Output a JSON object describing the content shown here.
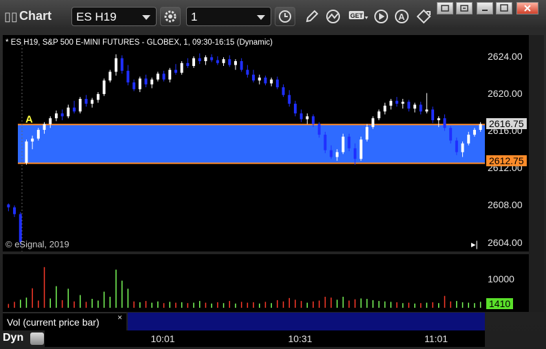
{
  "window": {
    "title": "Chart"
  },
  "toolbar": {
    "symbol": "ES H19",
    "interval": "1"
  },
  "chart": {
    "header": "* ES H19, S&P 500 E-MINI FUTURES - GLOBEX, 1, 09:30-16:15 (Dynamic)",
    "copyright": "© eSignal, 2019",
    "marker_label": "A",
    "price_axis": [
      "2624.00",
      "2620.00",
      "2616.00",
      "2612.00",
      "2608.00",
      "2604.00"
    ],
    "price_tags": {
      "last": "2616.75",
      "level": "2612.75"
    },
    "volume_axis": [
      "10000"
    ],
    "volume_tag": "1410",
    "time_axis": [
      "10:01",
      "10:31",
      "11:01"
    ],
    "volume_study_label": "Vol (current price bar)",
    "volume_close": "×",
    "mode_label": "Dyn",
    "colors": {
      "band": "#2f6bff",
      "line": "#ff8c2a",
      "up": "#ffffff",
      "down": "#1f2fff",
      "vol_up": "#7cff5a",
      "vol_down": "#ff3a2a"
    }
  },
  "chart_data": {
    "type": "candlestick",
    "ylim": [
      2604,
      2625
    ],
    "price_levels": [
      2616.75,
      2612.75
    ],
    "candles": [
      [
        2608.5,
        2608.6,
        2607.8,
        2608.2
      ],
      [
        2608.2,
        2608.4,
        2607.2,
        2607.5
      ],
      [
        2607.5,
        2607.7,
        2604.3,
        2604.6
      ],
      [
        2612.8,
        2615.2,
        2612.6,
        2615.0
      ],
      [
        2615.0,
        2615.6,
        2614.2,
        2615.3
      ],
      [
        2615.3,
        2616.4,
        2615.1,
        2616.2
      ],
      [
        2616.2,
        2617.0,
        2615.8,
        2616.8
      ],
      [
        2616.8,
        2617.6,
        2616.4,
        2617.4
      ],
      [
        2617.4,
        2618.2,
        2617.1,
        2617.9
      ],
      [
        2617.9,
        2618.3,
        2617.2,
        2617.6
      ],
      [
        2617.6,
        2618.8,
        2617.4,
        2618.5
      ],
      [
        2618.5,
        2619.2,
        2617.9,
        2618.1
      ],
      [
        2618.1,
        2619.6,
        2617.9,
        2619.4
      ],
      [
        2619.4,
        2619.8,
        2618.6,
        2618.9
      ],
      [
        2618.9,
        2619.5,
        2618.5,
        2619.3
      ],
      [
        2619.3,
        2620.1,
        2619.0,
        2619.9
      ],
      [
        2619.9,
        2621.5,
        2619.7,
        2621.3
      ],
      [
        2621.3,
        2622.4,
        2621.1,
        2622.2
      ],
      [
        2622.2,
        2624.0,
        2621.8,
        2623.6
      ],
      [
        2623.6,
        2623.9,
        2622.0,
        2622.3
      ],
      [
        2622.3,
        2622.9,
        2620.8,
        2621.1
      ],
      [
        2621.1,
        2621.4,
        2620.2,
        2620.4
      ],
      [
        2620.4,
        2621.7,
        2620.1,
        2621.5
      ],
      [
        2621.5,
        2621.9,
        2620.6,
        2620.9
      ],
      [
        2620.9,
        2621.6,
        2620.5,
        2621.4
      ],
      [
        2621.4,
        2622.2,
        2621.2,
        2622.0
      ],
      [
        2622.0,
        2622.3,
        2621.2,
        2621.4
      ],
      [
        2621.4,
        2622.6,
        2621.1,
        2622.4
      ],
      [
        2622.4,
        2623.0,
        2621.9,
        2622.1
      ],
      [
        2622.1,
        2623.3,
        2621.9,
        2623.1
      ],
      [
        2623.1,
        2623.6,
        2622.6,
        2622.8
      ],
      [
        2622.8,
        2623.8,
        2622.6,
        2623.6
      ],
      [
        2623.6,
        2624.1,
        2623.0,
        2623.3
      ],
      [
        2623.3,
        2623.9,
        2622.9,
        2623.7
      ],
      [
        2623.7,
        2624.0,
        2623.2,
        2623.4
      ],
      [
        2623.4,
        2623.8,
        2622.9,
        2623.1
      ],
      [
        2623.1,
        2623.7,
        2622.8,
        2623.5
      ],
      [
        2623.5,
        2623.9,
        2622.7,
        2622.9
      ],
      [
        2622.9,
        2623.5,
        2622.4,
        2623.3
      ],
      [
        2623.3,
        2623.6,
        2622.2,
        2622.4
      ],
      [
        2622.4,
        2622.9,
        2621.6,
        2621.9
      ],
      [
        2621.9,
        2622.4,
        2621.1,
        2621.3
      ],
      [
        2621.3,
        2621.9,
        2620.9,
        2621.6
      ],
      [
        2621.6,
        2621.8,
        2620.8,
        2621.0
      ],
      [
        2621.0,
        2621.6,
        2620.7,
        2621.4
      ],
      [
        2621.4,
        2621.7,
        2620.4,
        2620.6
      ],
      [
        2620.6,
        2620.9,
        2619.6,
        2619.8
      ],
      [
        2619.8,
        2620.3,
        2618.6,
        2618.9
      ],
      [
        2618.9,
        2619.2,
        2617.6,
        2617.9
      ],
      [
        2617.9,
        2618.3,
        2617.0,
        2617.3
      ],
      [
        2617.3,
        2617.9,
        2616.8,
        2617.6
      ],
      [
        2617.6,
        2617.8,
        2616.5,
        2616.8
      ],
      [
        2616.8,
        2617.0,
        2615.4,
        2615.7
      ],
      [
        2615.7,
        2616.0,
        2613.8,
        2614.1
      ],
      [
        2614.1,
        2614.6,
        2613.2,
        2613.4
      ],
      [
        2613.4,
        2614.2,
        2613.0,
        2613.9
      ],
      [
        2613.9,
        2615.8,
        2613.7,
        2615.5
      ],
      [
        2615.5,
        2615.8,
        2614.0,
        2614.3
      ],
      [
        2614.3,
        2614.8,
        2612.6,
        2613.2
      ],
      [
        2613.2,
        2615.5,
        2613.0,
        2615.2
      ],
      [
        2615.2,
        2616.8,
        2615.0,
        2616.5
      ],
      [
        2616.5,
        2617.6,
        2616.3,
        2617.4
      ],
      [
        2617.4,
        2618.3,
        2617.2,
        2618.1
      ],
      [
        2618.1,
        2619.0,
        2617.8,
        2618.7
      ],
      [
        2618.7,
        2619.4,
        2618.3,
        2619.2
      ],
      [
        2619.2,
        2619.6,
        2618.6,
        2618.9
      ],
      [
        2618.9,
        2619.4,
        2618.4,
        2619.1
      ],
      [
        2619.1,
        2619.3,
        2618.1,
        2618.4
      ],
      [
        2618.4,
        2619.0,
        2618.0,
        2618.8
      ],
      [
        2618.8,
        2619.1,
        2617.8,
        2618.1
      ],
      [
        2618.1,
        2620.0,
        2617.9,
        2618.3
      ],
      [
        2618.3,
        2618.6,
        2616.9,
        2617.2
      ],
      [
        2617.2,
        2617.6,
        2616.5,
        2617.4
      ],
      [
        2617.4,
        2617.8,
        2616.1,
        2616.4
      ],
      [
        2616.4,
        2616.6,
        2614.8,
        2615.1
      ],
      [
        2615.1,
        2615.4,
        2613.6,
        2613.9
      ],
      [
        2613.9,
        2615.0,
        2613.4,
        2614.8
      ],
      [
        2614.8,
        2616.0,
        2614.6,
        2615.7
      ],
      [
        2615.7,
        2616.4,
        2615.5,
        2616.2
      ],
      [
        2616.2,
        2617.0,
        2616.0,
        2616.8
      ]
    ],
    "volume": [
      {
        "v": 900,
        "up": false
      },
      {
        "v": 1400,
        "up": false
      },
      {
        "v": 1900,
        "up": true
      },
      {
        "v": 2400,
        "up": true
      },
      {
        "v": 4600,
        "up": false
      },
      {
        "v": 1700,
        "up": false
      },
      {
        "v": 9600,
        "up": false
      },
      {
        "v": 2200,
        "up": true
      },
      {
        "v": 5100,
        "up": true
      },
      {
        "v": 1800,
        "up": false
      },
      {
        "v": 4500,
        "up": true
      },
      {
        "v": 1500,
        "up": false
      },
      {
        "v": 3000,
        "up": true
      },
      {
        "v": 1400,
        "up": false
      },
      {
        "v": 2100,
        "up": true
      },
      {
        "v": 1700,
        "up": true
      },
      {
        "v": 3800,
        "up": true
      },
      {
        "v": 2600,
        "up": true
      },
      {
        "v": 9000,
        "up": true
      },
      {
        "v": 6400,
        "up": true
      },
      {
        "v": 4500,
        "up": true
      },
      {
        "v": 1500,
        "up": false
      },
      {
        "v": 1300,
        "up": true
      },
      {
        "v": 1600,
        "up": false
      },
      {
        "v": 1200,
        "up": true
      },
      {
        "v": 1500,
        "up": true
      },
      {
        "v": 1100,
        "up": false
      },
      {
        "v": 1400,
        "up": true
      },
      {
        "v": 1200,
        "up": false
      },
      {
        "v": 1300,
        "up": true
      },
      {
        "v": 1100,
        "up": false
      },
      {
        "v": 1200,
        "up": true
      },
      {
        "v": 1600,
        "up": true
      },
      {
        "v": 1200,
        "up": false
      },
      {
        "v": 1000,
        "up": true
      },
      {
        "v": 1300,
        "up": false
      },
      {
        "v": 1100,
        "up": true
      },
      {
        "v": 1600,
        "up": false
      },
      {
        "v": 1000,
        "up": true
      },
      {
        "v": 1400,
        "up": false
      },
      {
        "v": 1200,
        "up": false
      },
      {
        "v": 1300,
        "up": false
      },
      {
        "v": 1000,
        "up": true
      },
      {
        "v": 1400,
        "up": false
      },
      {
        "v": 1100,
        "up": true
      },
      {
        "v": 1800,
        "up": false
      },
      {
        "v": 1500,
        "up": false
      },
      {
        "v": 2300,
        "up": false
      },
      {
        "v": 1900,
        "up": false
      },
      {
        "v": 1600,
        "up": false
      },
      {
        "v": 1200,
        "up": true
      },
      {
        "v": 1500,
        "up": false
      },
      {
        "v": 1700,
        "up": false
      },
      {
        "v": 2600,
        "up": false
      },
      {
        "v": 2400,
        "up": false
      },
      {
        "v": 1900,
        "up": true
      },
      {
        "v": 2600,
        "up": true
      },
      {
        "v": 1700,
        "up": false
      },
      {
        "v": 2000,
        "up": false
      },
      {
        "v": 2200,
        "up": true
      },
      {
        "v": 2100,
        "up": true
      },
      {
        "v": 1800,
        "up": true
      },
      {
        "v": 1600,
        "up": true
      },
      {
        "v": 1500,
        "up": true
      },
      {
        "v": 1400,
        "up": true
      },
      {
        "v": 1300,
        "up": false
      },
      {
        "v": 1100,
        "up": true
      },
      {
        "v": 1200,
        "up": false
      },
      {
        "v": 1000,
        "up": true
      },
      {
        "v": 1100,
        "up": false
      },
      {
        "v": 1200,
        "up": true
      },
      {
        "v": 1300,
        "up": false
      },
      {
        "v": 1100,
        "up": true
      },
      {
        "v": 2800,
        "up": false
      },
      {
        "v": 1500,
        "up": false
      },
      {
        "v": 1600,
        "up": true
      },
      {
        "v": 1300,
        "up": true
      },
      {
        "v": 1200,
        "up": true
      },
      {
        "v": 1100,
        "up": true
      },
      {
        "v": 1410,
        "up": true
      }
    ],
    "vol_ylim": [
      0,
      12000
    ]
  }
}
